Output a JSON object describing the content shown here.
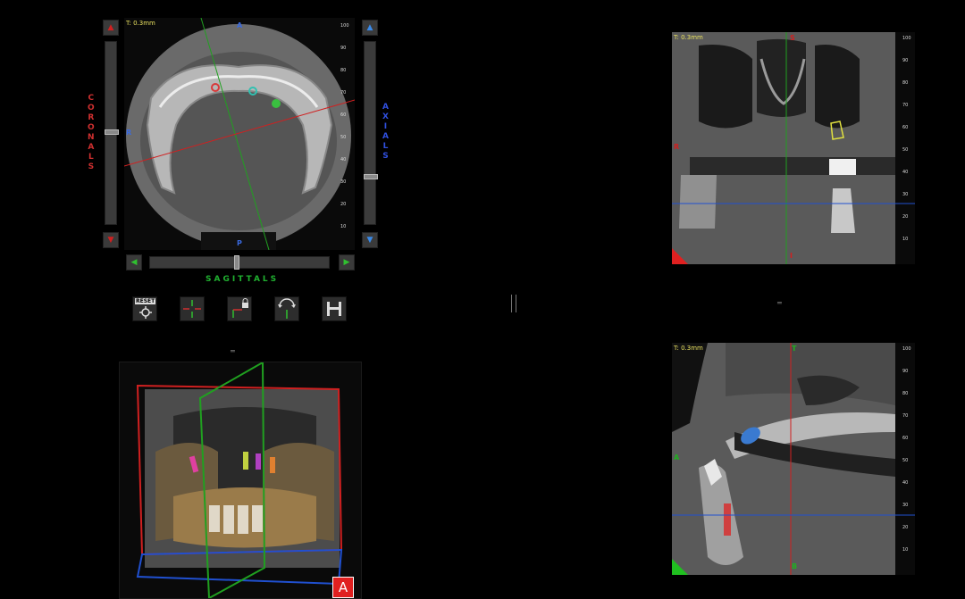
{
  "axial_view": {
    "thickness": "T: 0.3mm",
    "markers": {
      "top": "A",
      "left": "R",
      "bottom": "P"
    },
    "ruler_ticks": [
      "100",
      "90",
      "80",
      "70",
      "60",
      "50",
      "40",
      "30",
      "20",
      "10"
    ]
  },
  "coronal_label": [
    "C",
    "O",
    "R",
    "O",
    "N",
    "A",
    "L",
    "S"
  ],
  "axial_label": [
    "A",
    "X",
    "I",
    "A",
    "L",
    "S"
  ],
  "sagittal_label": "SAGITTALS",
  "toolbar": {
    "reset_label": "RESET"
  },
  "coronal_view": {
    "thickness": "T: 0.3mm",
    "markers": {
      "top": "S",
      "left": "R",
      "bottom": "I"
    },
    "ruler_ticks": [
      "100",
      "90",
      "80",
      "70",
      "60",
      "50",
      "40",
      "30",
      "20",
      "10"
    ]
  },
  "sagittal_view": {
    "thickness": "T: 0.3mm",
    "markers": {
      "top": "T",
      "left": "A",
      "bottom": "B"
    },
    "ruler_ticks": [
      "100",
      "90",
      "80",
      "70",
      "60",
      "50",
      "40",
      "30",
      "20",
      "10"
    ]
  },
  "volume_view": {
    "orientation_badge": "A"
  },
  "colors": {
    "red_axis": "#d02020",
    "blue_axis": "#2050d0",
    "green_axis": "#20a020",
    "thickness_text": "#e8e060"
  }
}
